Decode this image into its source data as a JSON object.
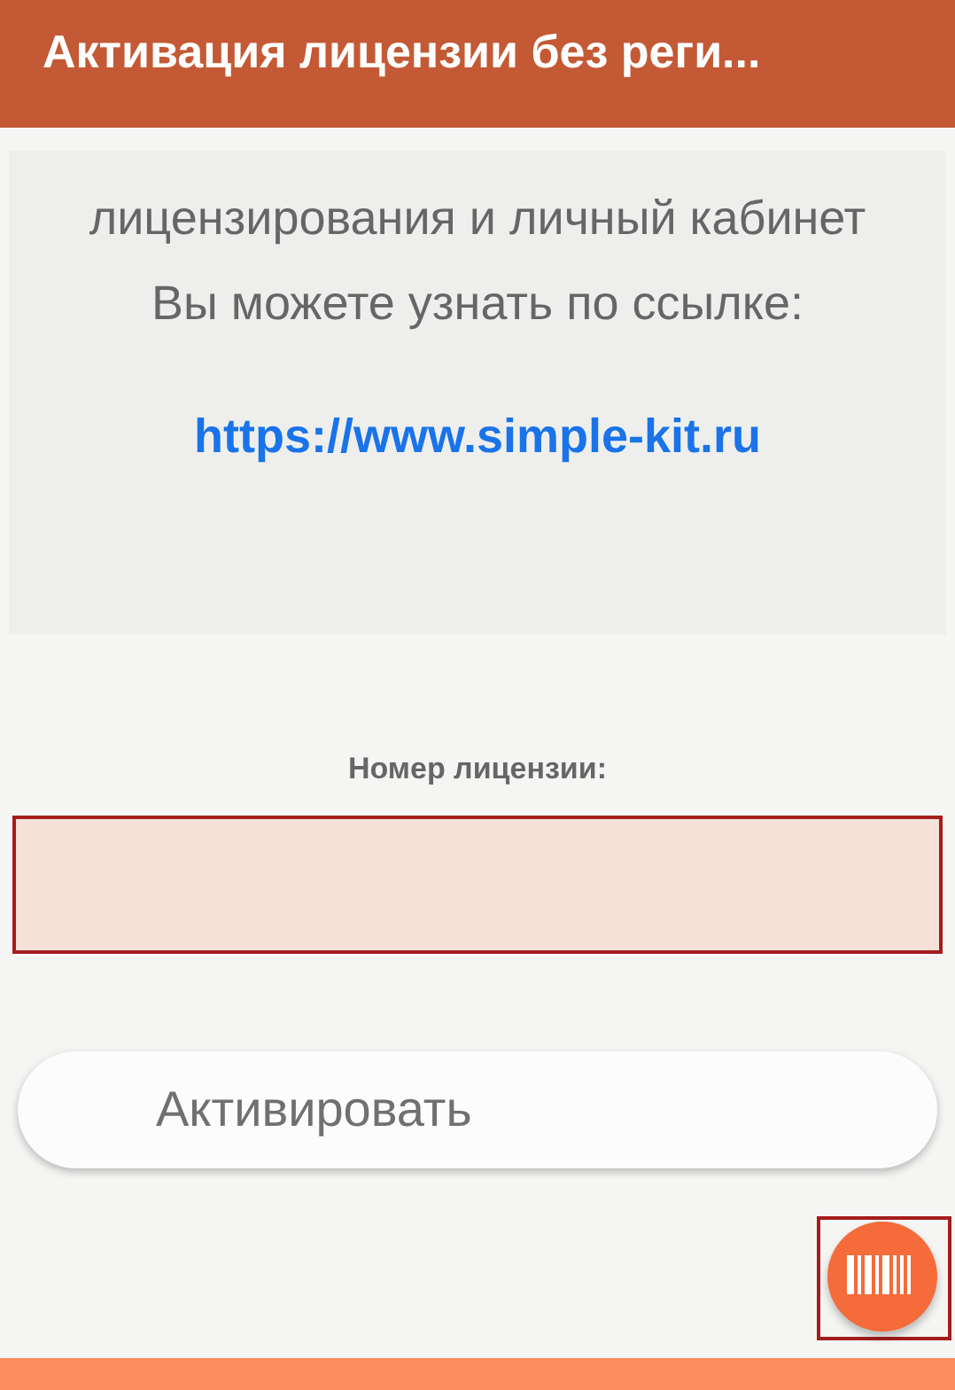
{
  "header": {
    "title": "Активация лицензии без реги..."
  },
  "info": {
    "text": "лицензирования и личный кабинет Вы можете узнать по ссылке:",
    "link": "https://www.simple-kit.ru"
  },
  "license_field": {
    "label": "Номер лицензии:",
    "invalid": true
  },
  "activate_button": {
    "label": "Активировать"
  },
  "scan_button": {
    "highlighted": true
  }
}
